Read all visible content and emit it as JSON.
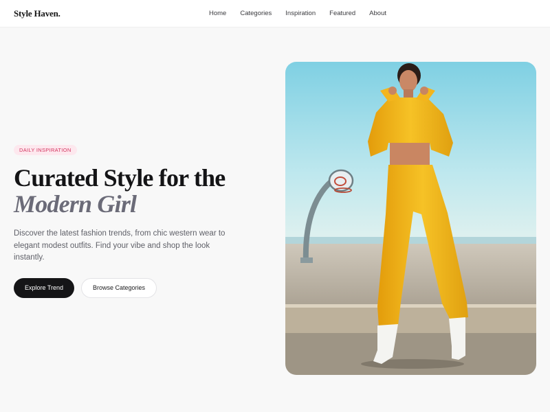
{
  "header": {
    "brand": "Style Haven.",
    "nav": [
      "Home",
      "Categories",
      "Inspiration",
      "Featured",
      "About"
    ]
  },
  "hero": {
    "badge": "DAILY INSPIRATION",
    "headline_line1": "Curated Style for the",
    "headline_line2": "Modern Girl",
    "description": "Discover the latest fashion trends, from chic western wear to elegant modest outfits. Find your vibe and shop the look instantly.",
    "primary_button": "Explore Trend",
    "secondary_button": "Browse Categories"
  },
  "colors": {
    "background": "#f8f8f8",
    "badge_bg": "#fde8ee",
    "badge_text": "#d3345f",
    "headline_accent": "#6b6b78",
    "primary_button": "#151517",
    "outfit_yellow": "#f2b418",
    "sky": "#8fd6e6"
  }
}
